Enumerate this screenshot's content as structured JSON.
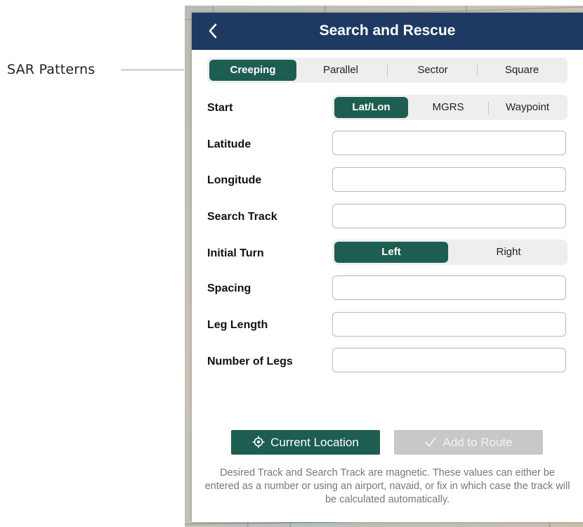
{
  "callout": {
    "label": "SAR Patterns"
  },
  "header": {
    "title": "Search and Rescue",
    "back_icon": "chevron-left-icon"
  },
  "patterns": {
    "options": [
      "Creeping",
      "Parallel",
      "Sector",
      "Square"
    ],
    "selected": "Creeping"
  },
  "form": {
    "start": {
      "label": "Start",
      "options": [
        "Lat/Lon",
        "MGRS",
        "Waypoint"
      ],
      "selected": "Lat/Lon"
    },
    "latitude": {
      "label": "Latitude",
      "value": ""
    },
    "longitude": {
      "label": "Longitude",
      "value": ""
    },
    "search_track": {
      "label": "Search Track",
      "value": ""
    },
    "initial_turn": {
      "label": "Initial Turn",
      "options": [
        "Left",
        "Right"
      ],
      "selected": "Left"
    },
    "spacing": {
      "label": "Spacing",
      "value": ""
    },
    "leg_length": {
      "label": "Leg Length",
      "value": ""
    },
    "number_of_legs": {
      "label": "Number of Legs",
      "value": ""
    }
  },
  "actions": {
    "current_location": {
      "label": "Current Location",
      "icon": "location-target-icon"
    },
    "add_to_route": {
      "label": "Add to Route",
      "icon": "checkmark-icon",
      "enabled": false
    }
  },
  "footnote": "Desired Track and Search Track are magnetic. These values can either be entered as a number or using an airport, navaid, or fix in which case the track will be calculated automatically.",
  "colors": {
    "nav": "#1e3a63",
    "accent": "#1d5e50",
    "disabled": "#c8c8c8"
  }
}
